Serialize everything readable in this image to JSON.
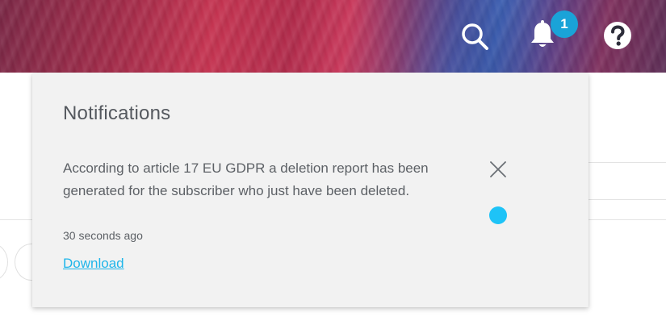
{
  "header": {
    "icons": [
      "search-icon",
      "bell-icon",
      "help-icon"
    ],
    "notification_count": "1"
  },
  "notifications_panel": {
    "title": "Notifications",
    "items": [
      {
        "message": "According to article 17 EU GDPR a deletion report has been generated for the subscriber who just have been deleted.",
        "time": "30 seconds ago",
        "link_label": "Download",
        "unread": true
      }
    ]
  },
  "colors": {
    "badge": "#1aa3d8",
    "link": "#1fb6ea",
    "unread_dot": "#1ec3f7",
    "panel_background": "#f2f2f2"
  }
}
